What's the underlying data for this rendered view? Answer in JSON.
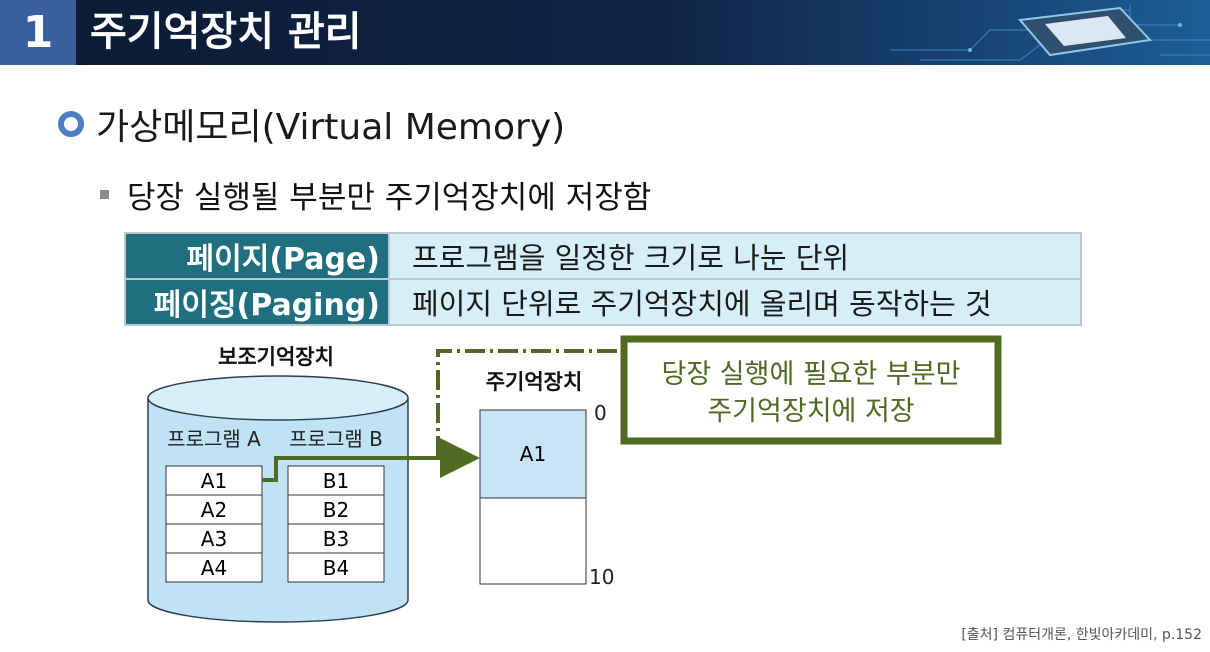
{
  "header": {
    "number": "1",
    "title": "주기억장치 관리"
  },
  "section": {
    "title": "가상메모리(Virtual Memory)"
  },
  "point": {
    "text": "당장 실행될 부분만 주기억장치에 저장함"
  },
  "definitions": [
    {
      "term": "페이지(Page)",
      "desc": "프로그램을 일정한 크기로 나눈 단위"
    },
    {
      "term": "페이징(Paging)",
      "desc": "페이지 단위로 주기억장치에 올리며 동작하는 것"
    }
  ],
  "diagram": {
    "secondary_label": "보조기억장치",
    "program_a_label": "프로그램 A",
    "program_b_label": "프로그램 B",
    "program_a_pages": [
      "A1",
      "A2",
      "A3",
      "A4"
    ],
    "program_b_pages": [
      "B1",
      "B2",
      "B3",
      "B4"
    ],
    "main_label": "주기억장치",
    "main_loaded_page": "A1",
    "addr_start": "0",
    "addr_end": "10",
    "callout_line1": "당장 실행에 필요한 부분만",
    "callout_line2": "주기억장치에 저장"
  },
  "source": "[출처] 컴퓨터개론, 한빛아카데미, p.152",
  "colors": {
    "header_bg": "#0f2547",
    "number_bg": "#3a5f9e",
    "term_bg": "#1f6f7f",
    "desc_bg": "#d6eef8",
    "cylinder": "#bfe3f4",
    "accent_green": "#4f6a23",
    "loaded_page": "#c6e6f7"
  }
}
